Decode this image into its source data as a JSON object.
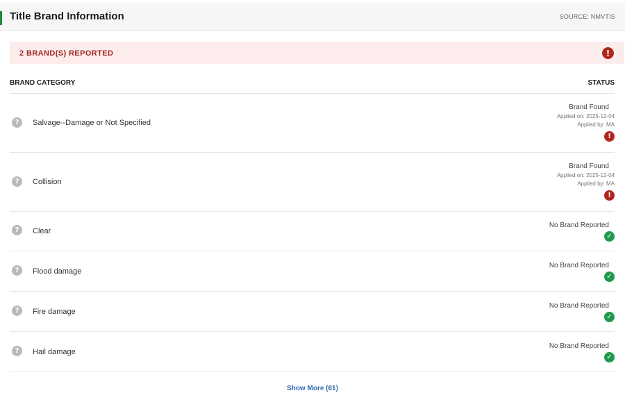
{
  "header": {
    "title": "Title Brand Information",
    "source": "SOURCE: NMVTIS"
  },
  "alert": {
    "text": "2 BRAND(S) REPORTED"
  },
  "columns": {
    "category": "BRAND CATEGORY",
    "status": "STATUS"
  },
  "rows": [
    {
      "label": "Salvage--Damage or Not Specified",
      "status": "Brand Found",
      "applied_on": "Applied on: 2025-12-04",
      "applied_by": "Applied by: MA",
      "state": "found"
    },
    {
      "label": "Collision",
      "status": "Brand Found",
      "applied_on": "Applied on: 2025-12-04",
      "applied_by": "Applied by: MA",
      "state": "found"
    },
    {
      "label": "Clear",
      "status": "No Brand Reported",
      "state": "clear"
    },
    {
      "label": "Flood damage",
      "status": "No Brand Reported",
      "state": "clear"
    },
    {
      "label": "Fire damage",
      "status": "No Brand Reported",
      "state": "clear"
    },
    {
      "label": "Hail damage",
      "status": "No Brand Reported",
      "state": "clear"
    }
  ],
  "show_more": {
    "label": "Show More (61)"
  },
  "colors": {
    "accent": "#1f8a3b",
    "alert_bg": "#fdecec",
    "alert_text": "#a0271f",
    "warn": "#b0261c",
    "ok": "#1f9a4a",
    "link": "#2d6cb5"
  },
  "icons": {
    "alert": "exclamation-circle-icon",
    "question": "question-circle-icon",
    "ok": "check-circle-icon"
  }
}
